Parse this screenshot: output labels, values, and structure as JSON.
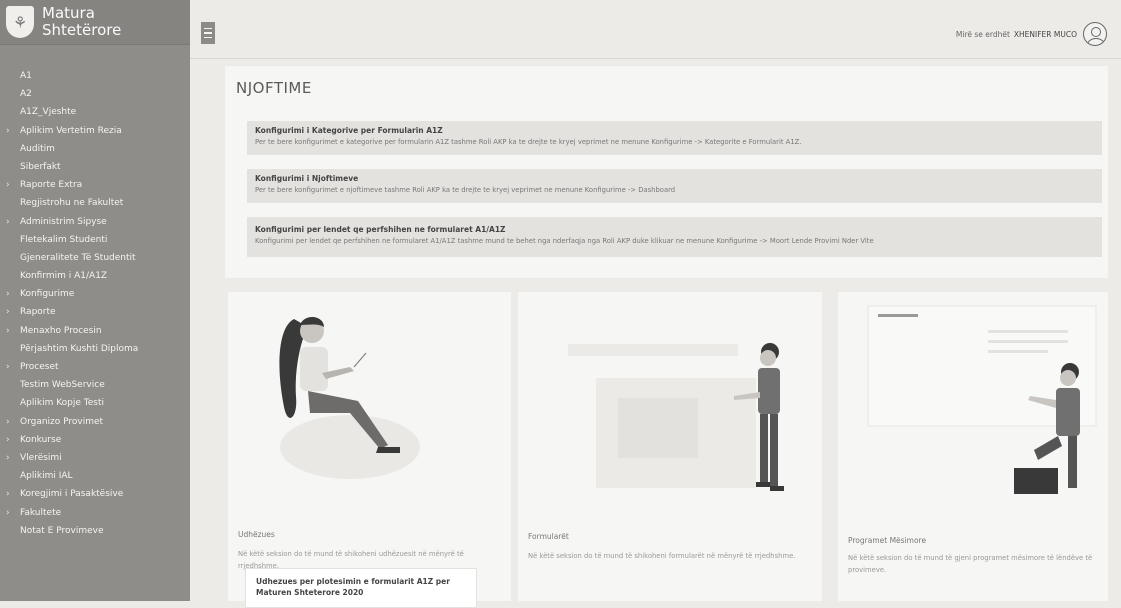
{
  "app": {
    "title_line1": "Matura",
    "title_line2": "Shtetërore"
  },
  "sidebar": {
    "items": [
      {
        "label": "A1",
        "chevron": false
      },
      {
        "label": "A2",
        "chevron": false
      },
      {
        "label": "A1Z_Vjeshte",
        "chevron": false
      },
      {
        "label": "Aplikim Vertetim Rezia",
        "chevron": true
      },
      {
        "label": "Auditim",
        "chevron": false
      },
      {
        "label": "Siberfakt",
        "chevron": false
      },
      {
        "label": "Raporte Extra",
        "chevron": true
      },
      {
        "label": "Regjistrohu ne Fakultet",
        "chevron": false
      },
      {
        "label": "Administrim Sipyse",
        "chevron": true
      },
      {
        "label": "Fletekalim Studenti",
        "chevron": false
      },
      {
        "label": "Gjeneralitete Të Studentit",
        "chevron": false
      },
      {
        "label": "Konfirmim i A1/A1Z",
        "chevron": false
      },
      {
        "label": "Konfigurime",
        "chevron": true
      },
      {
        "label": "Raporte",
        "chevron": true
      },
      {
        "label": "Menaxho Procesin",
        "chevron": true
      },
      {
        "label": "Përjashtim Kushti Diploma",
        "chevron": false
      },
      {
        "label": "Proceset",
        "chevron": true
      },
      {
        "label": "Testim WebService",
        "chevron": false
      },
      {
        "label": "Aplikim Kopje Testi",
        "chevron": false
      },
      {
        "label": "Organizo Provimet",
        "chevron": true
      },
      {
        "label": "Konkurse",
        "chevron": true
      },
      {
        "label": "Vlerësimi",
        "chevron": true
      },
      {
        "label": "Aplikimi IAL",
        "chevron": false
      },
      {
        "label": "Koregjimi i Pasaktësive",
        "chevron": true
      },
      {
        "label": "Fakultete",
        "chevron": true
      },
      {
        "label": "Notat E Provimeve",
        "chevron": false
      }
    ]
  },
  "header": {
    "greeting": "Mirë se erdhët",
    "username": "XHENIFER MUCO"
  },
  "notices": {
    "title": "NJOFTIME",
    "items": [
      {
        "title": "Konfigurimi i Kategorive per Formularin A1Z",
        "body": "Per te bere konfigurimet e kategorive per formularin A1Z tashme Roli AKP ka te drejte te kryej veprimet ne menune Konfigurime -> Kategorite e Formularit A1Z."
      },
      {
        "title": "Konfigurimi i Njoftimeve",
        "body": "Per te bere konfigurimet e njoftimeve tashme Roli AKP ka te drejte te kryej veprimet ne menune Konfigurime -> Dashboard"
      },
      {
        "title": "Konfigurimi per lendet qe perfshihen ne formularet A1/A1Z",
        "body": "Konfigurimi per lendet qe perfshihen ne formularet A1/A1Z tashme mund te behet nga nderfaqja nga Roli AKP duke klikuar ne menune Konfigurime -> Moort Lende Provimi Nder Vite"
      }
    ]
  },
  "cards": [
    {
      "title": "Udhëzues",
      "desc": "Në këtë seksion do të mund të shikoheni udhëzuesit në mënyrë të rrjedhshme.",
      "guide": "Udhezues per plotesimin e formularit A1Z per Maturen Shteterore 2020"
    },
    {
      "title": "Formularët",
      "desc": "Në këtë seksion do të mund të shikoheni formularët në mënyrë të rrjedhshme.",
      "guide": ""
    },
    {
      "title": "Programet Mësimore",
      "desc": "Në këtë seksion do të mund të gjeni programet mësimore të lëndëve të provimeve.",
      "guide": ""
    }
  ]
}
